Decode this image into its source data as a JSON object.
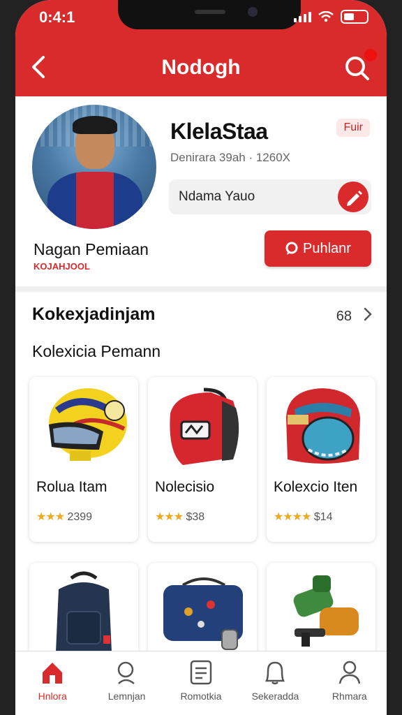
{
  "status_bar": {
    "time": "0:4:1"
  },
  "header": {
    "title": "Nodogh",
    "notification_count": ""
  },
  "profile": {
    "name": "KlelaStaa",
    "tag": "Fuir",
    "meta": "Denirara 39ah · 1260X",
    "nickname_value": "Ndama Yauo",
    "player_name": "Nagan Pemiaan",
    "player_sub": "KOJAHJOOL",
    "publish_label": "Puhlanr"
  },
  "section": {
    "title": "Kokexjadinjam",
    "count": "68",
    "subtitle": "Kolexicia Pemann"
  },
  "items": [
    {
      "title": "Rolua Itam",
      "stars": "★★★",
      "price": "2399",
      "icon": "helmet-image"
    },
    {
      "title": "Nolecisio",
      "stars": "★★★",
      "price": "$38",
      "icon": "bag-image"
    },
    {
      "title": "Kolexcio Iten",
      "stars": "★★★★",
      "price": "$14",
      "icon": "gauntlet-image"
    },
    {
      "title": "",
      "stars": "",
      "price": "",
      "icon": "backpack-image"
    },
    {
      "title": "",
      "stars": "",
      "price": "",
      "icon": "duffel-image"
    },
    {
      "title": "",
      "stars": "",
      "price": "",
      "icon": "gear-image"
    }
  ],
  "nav": [
    {
      "label": "Hnlora",
      "icon": "home-icon",
      "active": true
    },
    {
      "label": "Lemnjan",
      "icon": "search-icon"
    },
    {
      "label": "Romotkia",
      "icon": "list-icon"
    },
    {
      "label": "Sekeradda",
      "icon": "bell-icon"
    },
    {
      "label": "Rhmara",
      "icon": "profile-icon"
    }
  ],
  "colors": {
    "accent": "#d92b2b",
    "star": "#f0a820"
  }
}
